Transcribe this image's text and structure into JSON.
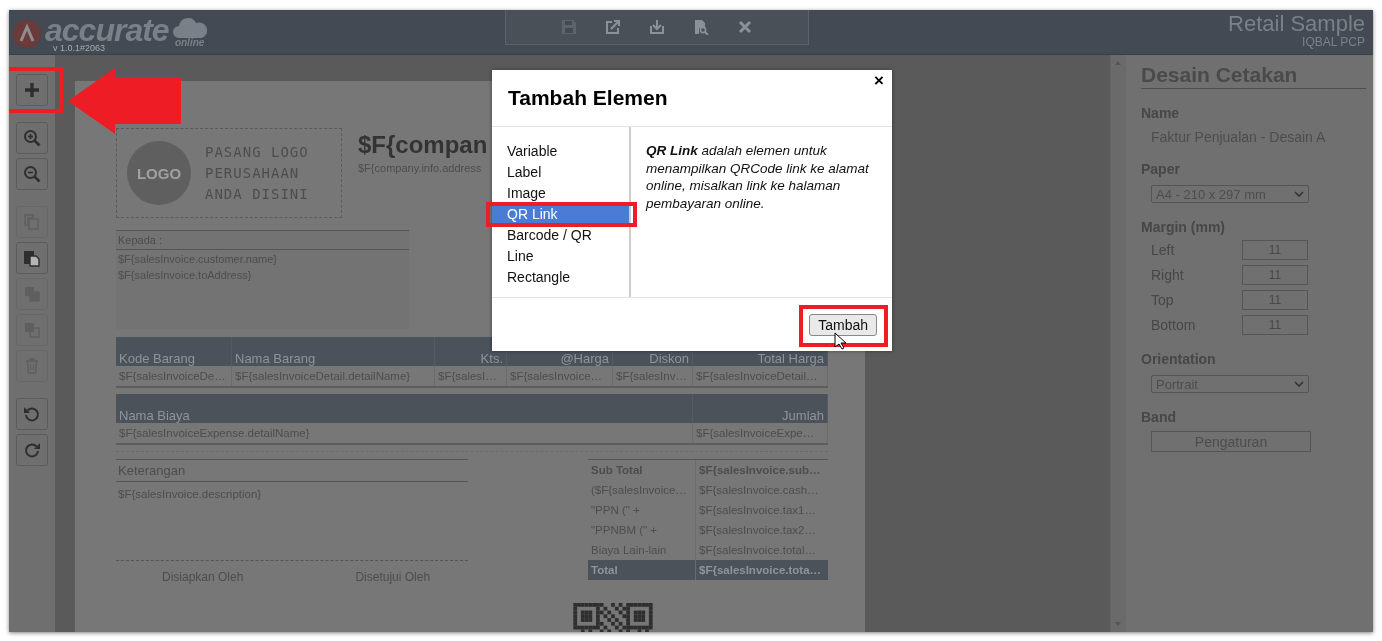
{
  "app": {
    "logo_text": "accurate",
    "logo_sub": "online",
    "version": "v 1.0.1#2063",
    "company": "Retail Sample",
    "user": "IQBAL PCP"
  },
  "top_toolbar": [
    {
      "kind": "save",
      "disabled": true
    },
    {
      "kind": "export",
      "disabled": false
    },
    {
      "kind": "import",
      "disabled": false
    },
    {
      "kind": "preview",
      "disabled": false
    },
    {
      "kind": "close",
      "disabled": false
    }
  ],
  "left_toolbar": [
    {
      "kind": "add",
      "disabled": false,
      "annotated": true
    },
    {
      "kind": "zoom-in",
      "disabled": false,
      "annotated": false
    },
    {
      "kind": "zoom-out",
      "disabled": false,
      "annotated": false
    },
    {
      "kind": "copy",
      "disabled": true,
      "annotated": false
    },
    {
      "kind": "paste",
      "disabled": false,
      "annotated": false
    },
    {
      "kind": "front",
      "disabled": true,
      "annotated": false
    },
    {
      "kind": "back",
      "disabled": true,
      "annotated": false
    },
    {
      "kind": "delete",
      "disabled": true,
      "annotated": false
    },
    {
      "kind": "undo",
      "disabled": false,
      "annotated": false
    },
    {
      "kind": "redo",
      "disabled": false,
      "annotated": false
    }
  ],
  "document": {
    "logo_badge": "LOGO",
    "logo_lines": [
      "PASANG LOGO",
      "PERUSAHAAN",
      "ANDA DISINI"
    ],
    "company_title": "$F{compan",
    "company_address": "$F{company.info.address",
    "recipient_label": "Kepada :",
    "recipient_lines": [
      "$F{salesInvoice.customer.name}",
      "$F{salesInvoice.toAddress}"
    ],
    "detail_columns": [
      "Kode Barang",
      "Nama Barang",
      "Kts.",
      "@Harga",
      "Diskon",
      "Total Harga"
    ],
    "detail_row": [
      "$F{salesInvoiceDe…",
      "$F{salesInvoiceDetail.detailName}",
      "$F{salesI…",
      "$F{salesInvoice…",
      "$F{salesInv…",
      "$F{salesInvoiceDetail…"
    ],
    "expense_columns": [
      "Nama Biaya",
      "Jumlah"
    ],
    "expense_row": [
      "$F{salesInvoiceExpense.detailName}",
      "$F{salesInvoiceExpe…"
    ],
    "notes_label": "Keterangan",
    "notes_value": "$F{salesInvoice.description}",
    "signatures": [
      "Disiapkan Oleh",
      "Disetujui Oleh"
    ],
    "totals": [
      {
        "kind": "subtotal",
        "label": "Sub Total",
        "value": "$F{salesInvoice.sub…"
      },
      {
        "kind": "line",
        "label": "($F{salesInvoice…",
        "value": "$F{salesInvoice.cash…"
      },
      {
        "kind": "line",
        "label": "\"PPN (\" +",
        "value": "$F{salesInvoice.tax1…"
      },
      {
        "kind": "line",
        "label": "\"PPNBM (\" +",
        "value": "$F{salesInvoice.tax2…"
      },
      {
        "kind": "line",
        "label": "Biaya Lain-lain",
        "value": "$F{salesInvoice.total…"
      },
      {
        "kind": "total",
        "label": "Total",
        "value": "$F{salesInvoice.tota…"
      }
    ]
  },
  "properties": {
    "title": "Desain Cetakan",
    "name_label": "Name",
    "name_value": "Faktur Penjualan - Desain A",
    "paper_label": "Paper",
    "paper_value": "A4 - 210 x 297 mm",
    "margin_label": "Margin (mm)",
    "margins": [
      {
        "label": "Left",
        "value": "11"
      },
      {
        "label": "Right",
        "value": "11"
      },
      {
        "label": "Top",
        "value": "11"
      },
      {
        "label": "Bottom",
        "value": "11"
      }
    ],
    "orientation_label": "Orientation",
    "orientation_value": "Portrait",
    "band_label": "Band",
    "band_button": "Pengaturan"
  },
  "dialog": {
    "title": "Tambah Elemen",
    "close": "×",
    "items": [
      {
        "label": "Variable",
        "selected": false
      },
      {
        "label": "Label",
        "selected": false
      },
      {
        "label": "Image",
        "selected": false
      },
      {
        "label": "QR Link",
        "selected": true
      },
      {
        "label": "Barcode / QR",
        "selected": false
      },
      {
        "label": "Line",
        "selected": false
      },
      {
        "label": "Rectangle",
        "selected": false
      }
    ],
    "description": "**QR Link** adalah elemen untuk menampilkan QRCode link ke alamat online, misalkan link ke halaman pembayaran online.",
    "button": "Tambah",
    "button_annotated": true
  }
}
